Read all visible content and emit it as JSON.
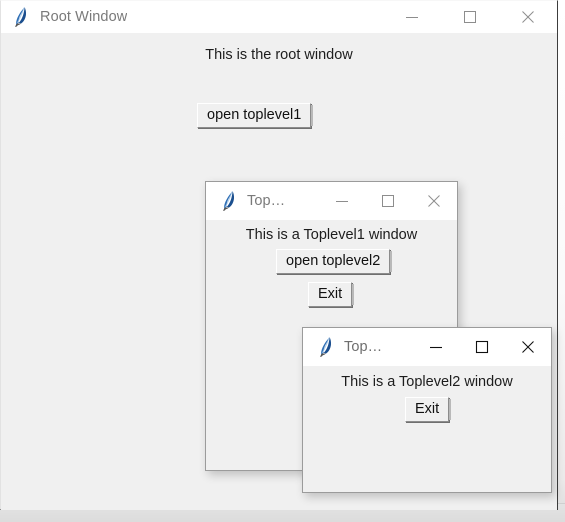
{
  "app": {
    "platform_icon": "tk-feather-icon"
  },
  "desktop": {
    "taskbar_ticks": 3
  },
  "root_window": {
    "title": "Root Window",
    "state": "inactive",
    "icon": "tk-feather-icon",
    "message": "This is the root window",
    "open_toplevel1_label": "open toplevel1",
    "controls": {
      "minimize": "minimize-icon",
      "maximize": "maximize-icon",
      "close": "close-icon"
    }
  },
  "toplevel1_window": {
    "title": "Top…",
    "state": "inactive",
    "icon": "tk-feather-icon",
    "message": "This is a Toplevel1 window",
    "open_toplevel2_label": "open toplevel2",
    "exit_label": "Exit",
    "controls": {
      "minimize": "minimize-icon",
      "maximize": "maximize-icon",
      "close": "close-icon"
    }
  },
  "toplevel2_window": {
    "title": "Top…",
    "state": "active",
    "icon": "tk-feather-icon",
    "message": "This is a Toplevel2 window",
    "exit_label": "Exit",
    "controls": {
      "minimize": "minimize-icon",
      "maximize": "maximize-icon",
      "close": "close-icon"
    }
  },
  "colors": {
    "window_body": "#f0f0f0",
    "titlebar": "#ffffff",
    "title_text_inactive": "#7a7a7a",
    "glyph_inactive": "#8d8d8d",
    "glyph_active": "#101010",
    "text": "#1d1d1d",
    "button_face": "#f0f0f0",
    "button_shadow": "#8c8c8c",
    "feather_blue": "#2f6fb5"
  }
}
